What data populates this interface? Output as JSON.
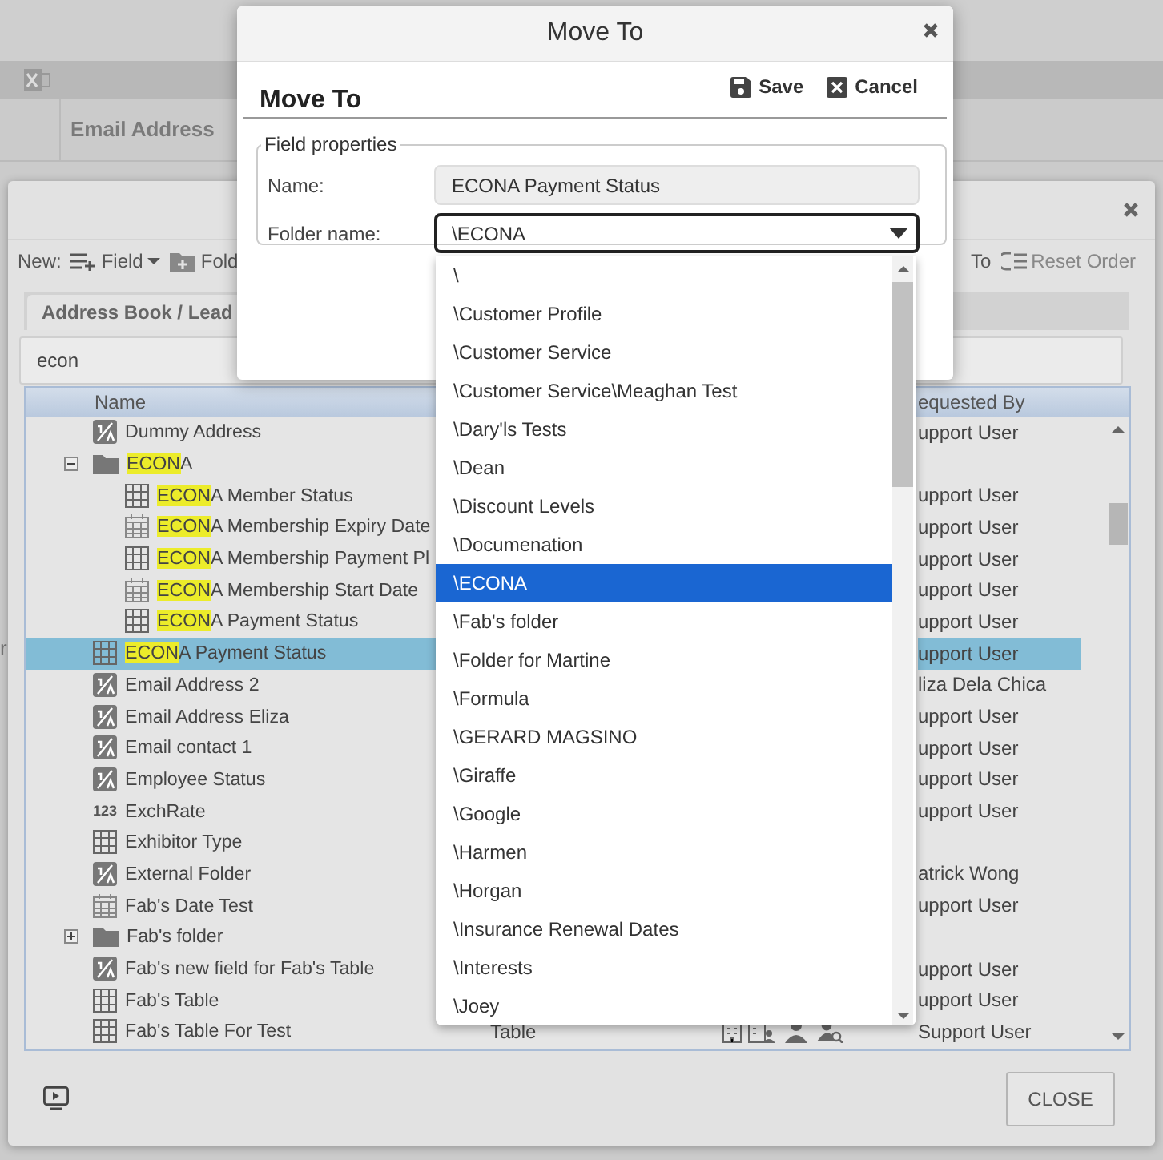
{
  "background": {
    "header_column": "Email Address",
    "left_fragment": "r"
  },
  "field_manager": {
    "toolbar": {
      "new_label": "New:",
      "field_button": "Field",
      "folder_button": "Fold",
      "move_fragment": "To",
      "reset_order": "Reset Order"
    },
    "tab": {
      "label": "Address Book / Lead"
    },
    "search": {
      "value": "econ"
    },
    "table": {
      "columns": [
        "Name",
        "equested By"
      ],
      "rows": [
        {
          "kind": "text",
          "parts": [
            {
              "text": "Dummy Address",
              "highlighted": false
            }
          ],
          "requested_by": "upport User",
          "selected": false
        },
        {
          "kind": "folder",
          "expanded": true,
          "parts": [
            {
              "text": "ECON",
              "highlighted": true
            },
            {
              "text": "A",
              "highlighted": false
            }
          ],
          "selected": false,
          "children": [
            {
              "kind": "table",
              "parts": [
                {
                  "text": "ECON",
                  "highlighted": true
                },
                {
                  "text": "A Member Status",
                  "highlighted": false
                }
              ],
              "requested_by": "upport User",
              "selected": false
            },
            {
              "kind": "date",
              "parts": [
                {
                  "text": "ECON",
                  "highlighted": true
                },
                {
                  "text": "A Membership Expiry Date",
                  "highlighted": false
                }
              ],
              "requested_by": "upport User",
              "selected": false
            },
            {
              "kind": "table",
              "parts": [
                {
                  "text": "ECON",
                  "highlighted": true
                },
                {
                  "text": "A Membership Payment Pl",
                  "highlighted": false
                }
              ],
              "requested_by": "upport User",
              "selected": false
            },
            {
              "kind": "date",
              "parts": [
                {
                  "text": "ECON",
                  "highlighted": true
                },
                {
                  "text": "A Membership Start Date",
                  "highlighted": false
                }
              ],
              "requested_by": "upport User",
              "selected": false
            },
            {
              "kind": "table",
              "parts": [
                {
                  "text": "ECON",
                  "highlighted": true
                },
                {
                  "text": "A Payment Status",
                  "highlighted": false
                }
              ],
              "requested_by": "upport User",
              "selected": false
            }
          ]
        },
        {
          "kind": "table",
          "parts": [
            {
              "text": "ECON",
              "highlighted": true
            },
            {
              "text": "A Payment Status",
              "highlighted": false
            }
          ],
          "requested_by": "upport User",
          "selected": true
        },
        {
          "kind": "text",
          "parts": [
            {
              "text": "Email Address 2",
              "highlighted": false
            }
          ],
          "requested_by": "liza Dela Chica",
          "selected": false
        },
        {
          "kind": "text",
          "parts": [
            {
              "text": "Email Address Eliza",
              "highlighted": false
            }
          ],
          "requested_by": "upport User",
          "selected": false
        },
        {
          "kind": "text",
          "parts": [
            {
              "text": "Email contact 1",
              "highlighted": false
            }
          ],
          "requested_by": "upport User",
          "selected": false
        },
        {
          "kind": "text",
          "parts": [
            {
              "text": "Employee Status",
              "highlighted": false
            }
          ],
          "requested_by": "upport User",
          "selected": false
        },
        {
          "kind": "number",
          "icon_label": "123",
          "parts": [
            {
              "text": "ExchRate",
              "highlighted": false
            }
          ],
          "requested_by": "upport User",
          "selected": false
        },
        {
          "kind": "table",
          "parts": [
            {
              "text": "Exhibitor Type",
              "highlighted": false
            }
          ],
          "selected": false
        },
        {
          "kind": "text",
          "parts": [
            {
              "text": "External Folder",
              "highlighted": false
            }
          ],
          "requested_by": "atrick Wong",
          "selected": false
        },
        {
          "kind": "date",
          "parts": [
            {
              "text": "Fab's Date Test",
              "highlighted": false
            }
          ],
          "requested_by": "upport User",
          "selected": false
        },
        {
          "kind": "folder",
          "expanded": false,
          "parts": [
            {
              "text": "Fab's folder",
              "highlighted": false
            }
          ],
          "selected": false
        },
        {
          "kind": "text",
          "parts": [
            {
              "text": "Fab's new field for Fab's Table",
              "highlighted": false
            }
          ],
          "requested_by": "upport User",
          "selected": false
        },
        {
          "kind": "table",
          "parts": [
            {
              "text": "Fab's Table",
              "highlighted": false
            }
          ],
          "requested_by": "upport User",
          "selected": false
        },
        {
          "kind": "table",
          "parts": [
            {
              "text": "Fab's Table For Test",
              "highlighted": false
            }
          ],
          "type": "Table",
          "access_icons": true,
          "requested_by": "Support User",
          "selected": false
        }
      ]
    },
    "close_button": "CLOSE"
  },
  "move_dialog": {
    "title": "Move To",
    "heading": "Move To",
    "save": "Save",
    "cancel": "Cancel",
    "legend": "Field properties",
    "name_label": "Name:",
    "name_value": "ECONA Payment Status",
    "folder_label": "Folder name:",
    "folder_value": "\\ECONA",
    "options": [
      {
        "label": "\\",
        "selected": false
      },
      {
        "label": "\\Customer Profile",
        "selected": false
      },
      {
        "label": "\\Customer Service",
        "selected": false
      },
      {
        "label": "\\Customer Service\\Meaghan Test",
        "selected": false
      },
      {
        "label": "\\Dary'ls Tests",
        "selected": false
      },
      {
        "label": "\\Dean",
        "selected": false
      },
      {
        "label": "\\Discount Levels",
        "selected": false
      },
      {
        "label": "\\Documenation",
        "selected": false
      },
      {
        "label": "\\ECONA",
        "selected": true
      },
      {
        "label": "\\Fab's folder",
        "selected": false
      },
      {
        "label": "\\Folder for Martine",
        "selected": false
      },
      {
        "label": "\\Formula",
        "selected": false
      },
      {
        "label": "\\GERARD MAGSINO",
        "selected": false
      },
      {
        "label": "\\Giraffe",
        "selected": false
      },
      {
        "label": "\\Google",
        "selected": false
      },
      {
        "label": "\\Harmen",
        "selected": false
      },
      {
        "label": "\\Horgan",
        "selected": false
      },
      {
        "label": "\\Insurance Renewal Dates",
        "selected": false
      },
      {
        "label": "\\Interests",
        "selected": false
      },
      {
        "label": "\\Joey",
        "selected": false
      }
    ]
  }
}
